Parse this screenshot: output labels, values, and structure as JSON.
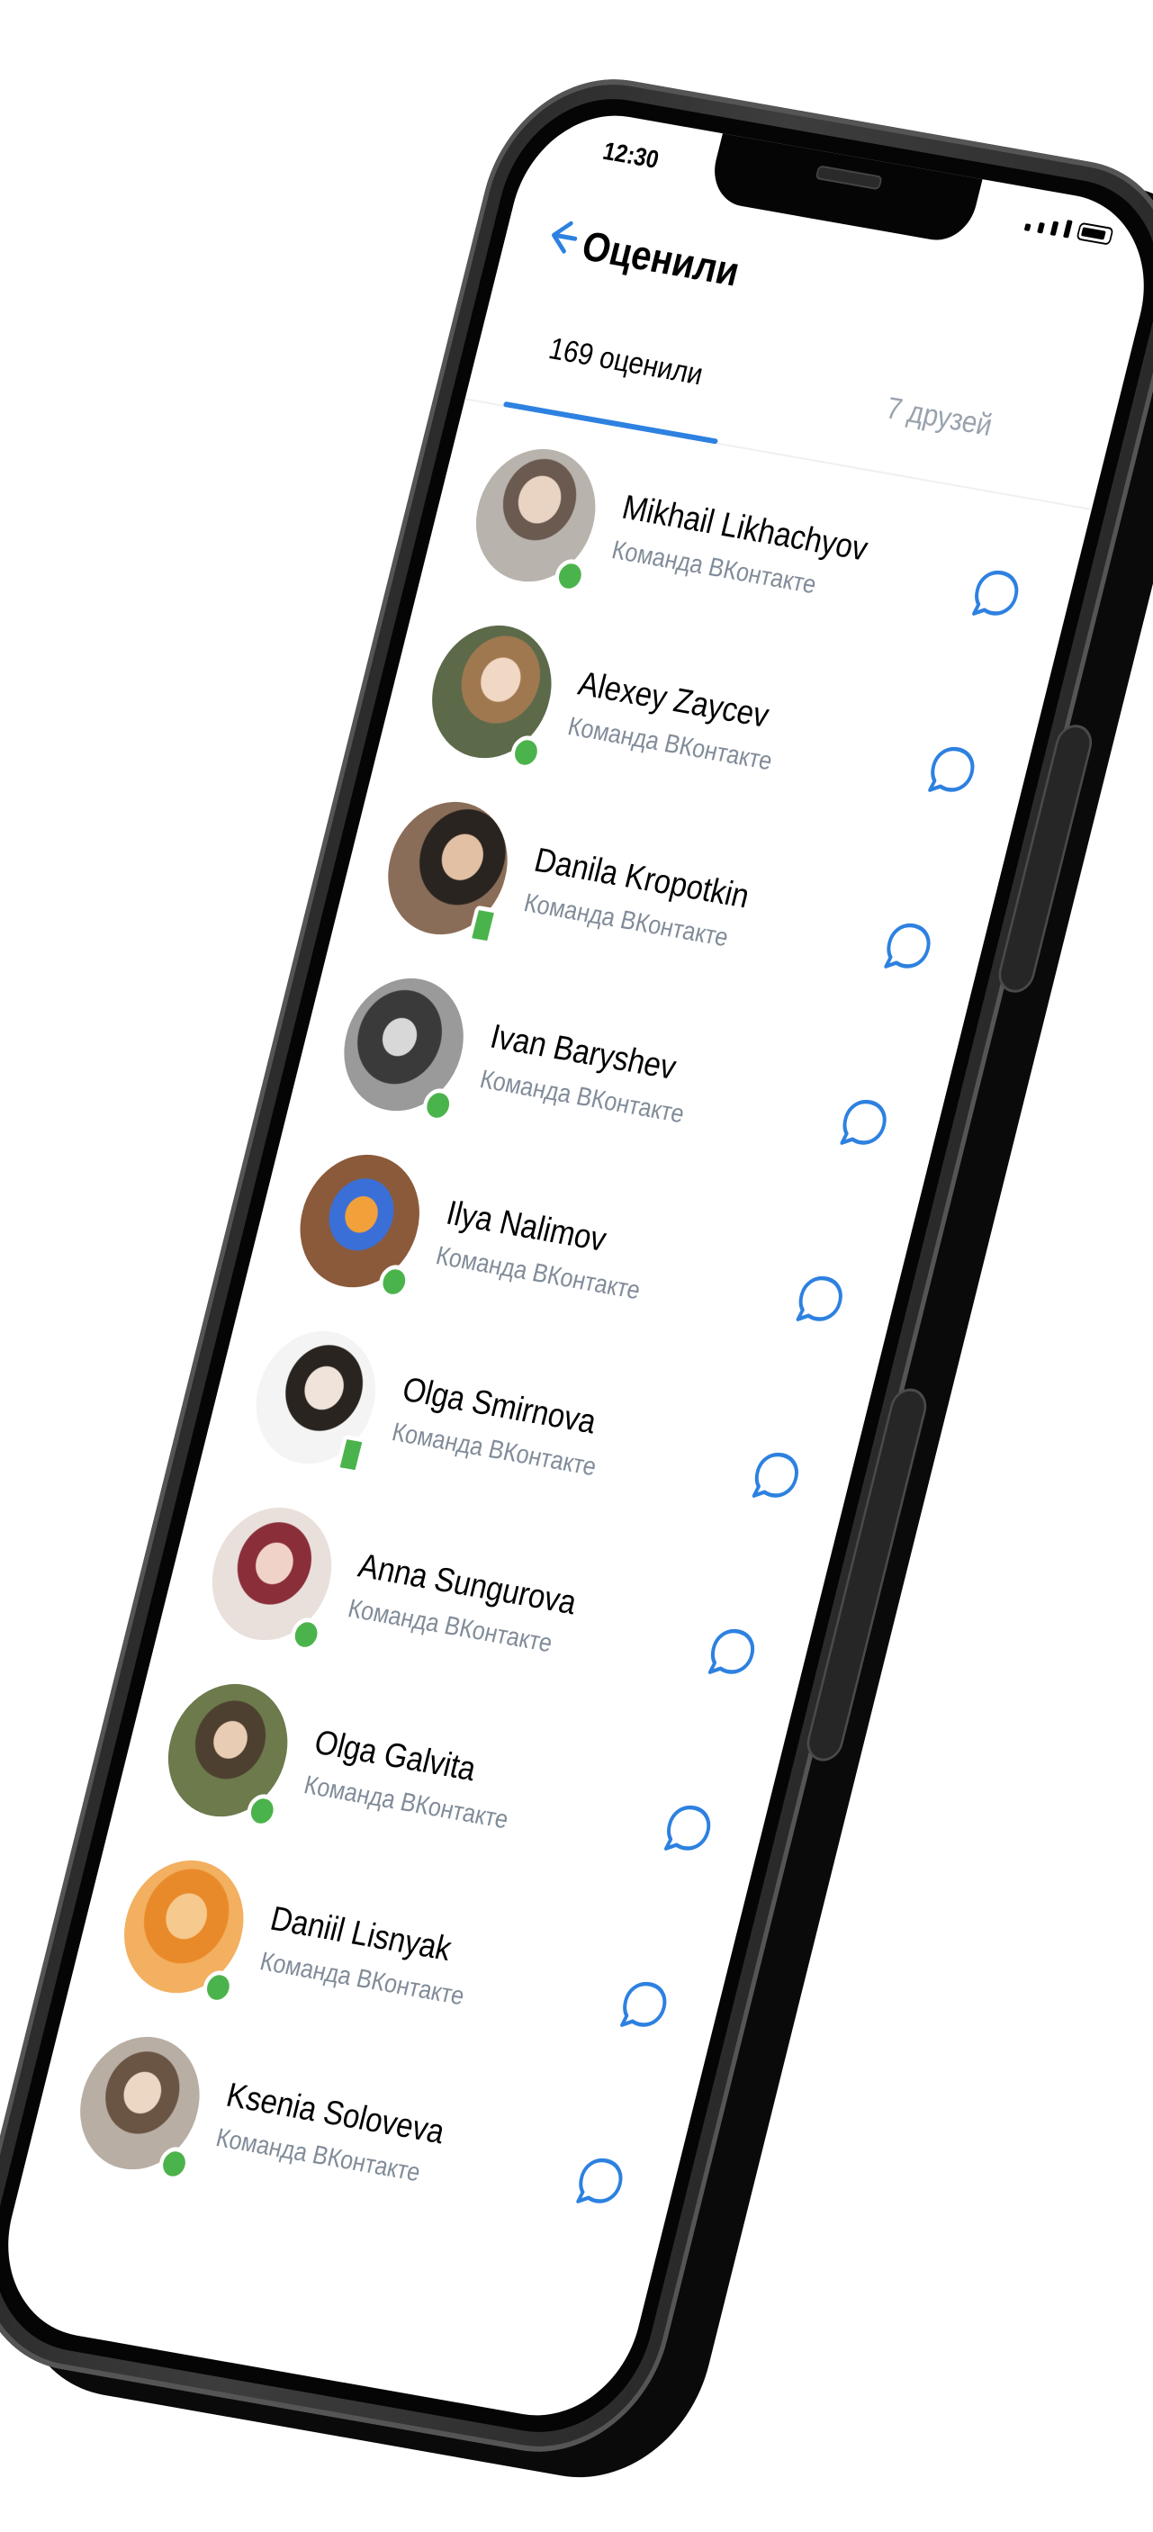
{
  "status_bar": {
    "time": "12:30"
  },
  "header": {
    "title": "Оценили"
  },
  "tabs": [
    {
      "label": "169 оценили",
      "active": true
    },
    {
      "label": "7 друзей",
      "active": false
    }
  ],
  "users": [
    {
      "name": "Mikhail Likhachyov",
      "subtitle": "Команда ВКонтакте",
      "online": "desktop"
    },
    {
      "name": "Alexey Zaycev",
      "subtitle": "Команда ВКонтакте",
      "online": "desktop"
    },
    {
      "name": "Danila Kropotkin",
      "subtitle": "Команда ВКонтакте",
      "online": "mobile"
    },
    {
      "name": "Ivan Baryshev",
      "subtitle": "Команда ВКонтакте",
      "online": "desktop"
    },
    {
      "name": "Ilya Nalimov",
      "subtitle": "Команда ВКонтакте",
      "online": "desktop"
    },
    {
      "name": "Olga Smirnova",
      "subtitle": "Команда ВКонтакте",
      "online": "mobile"
    },
    {
      "name": "Anna Sungurova",
      "subtitle": "Команда ВКонтакте",
      "online": "desktop"
    },
    {
      "name": "Olga Galvita",
      "subtitle": "Команда ВКонтакте",
      "online": "desktop"
    },
    {
      "name": "Daniil Lisnyak",
      "subtitle": "Команда ВКонтакте",
      "online": "desktop"
    },
    {
      "name": "Ksenia Soloveva",
      "subtitle": "Команда ВКонтакте",
      "online": "desktop"
    }
  ],
  "colors": {
    "accent": "#2d81e0",
    "online": "#4bb34b",
    "secondary_text": "#818c99",
    "inactive_tab": "#99a2ad",
    "phone_frame": "#333333"
  },
  "icons": {
    "back": "arrow-left-icon",
    "message": "message-bubble-icon"
  }
}
